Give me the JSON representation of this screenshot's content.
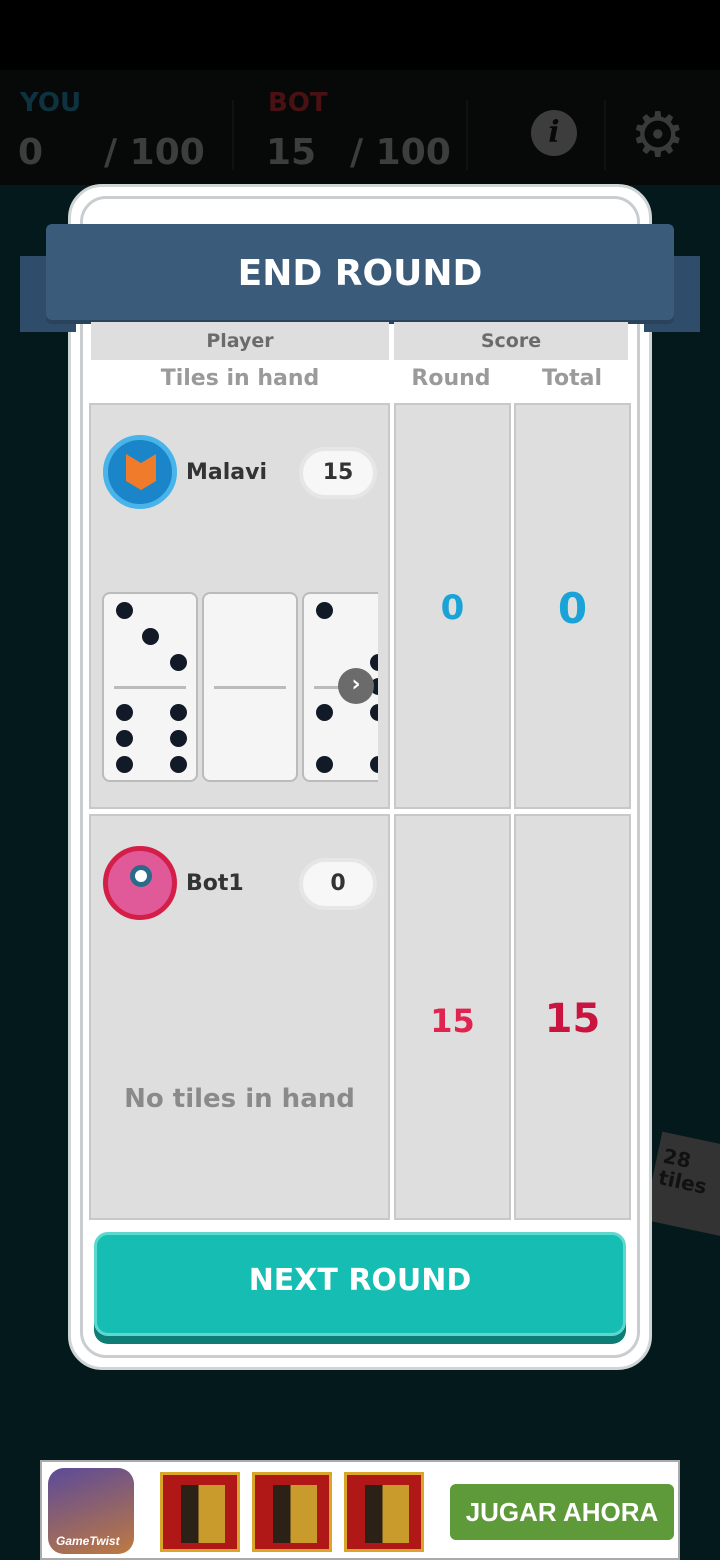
{
  "hud": {
    "you_label": "YOU",
    "you_score": "0",
    "you_target": "/ 100",
    "bot_label": "BOT",
    "bot_score": "15",
    "bot_target": "/ 100",
    "info_icon": "info-icon",
    "settings_icon": "gear-icon",
    "you_color": "#0d3340",
    "bot_color": "#4a1114"
  },
  "side_counter": {
    "count": "28",
    "unit": "tiles"
  },
  "dialog": {
    "title": "END ROUND",
    "headers": {
      "player": "Player",
      "score": "Score",
      "tiles_in_hand": "Tiles in hand",
      "round": "Round",
      "total": "Total"
    },
    "players": [
      {
        "name": "Malavi",
        "tiles": "15",
        "round": "0",
        "total": "0",
        "color": "#1aa3d6"
      },
      {
        "name": "Bot1",
        "tiles": "0",
        "round": "15",
        "total": "15",
        "color": "#e0244f",
        "empty_text": "No tiles in hand"
      }
    ],
    "next_button": "NEXT ROUND"
  },
  "ad": {
    "brand": "GameTwist",
    "cta": "JUGAR AHORA"
  }
}
